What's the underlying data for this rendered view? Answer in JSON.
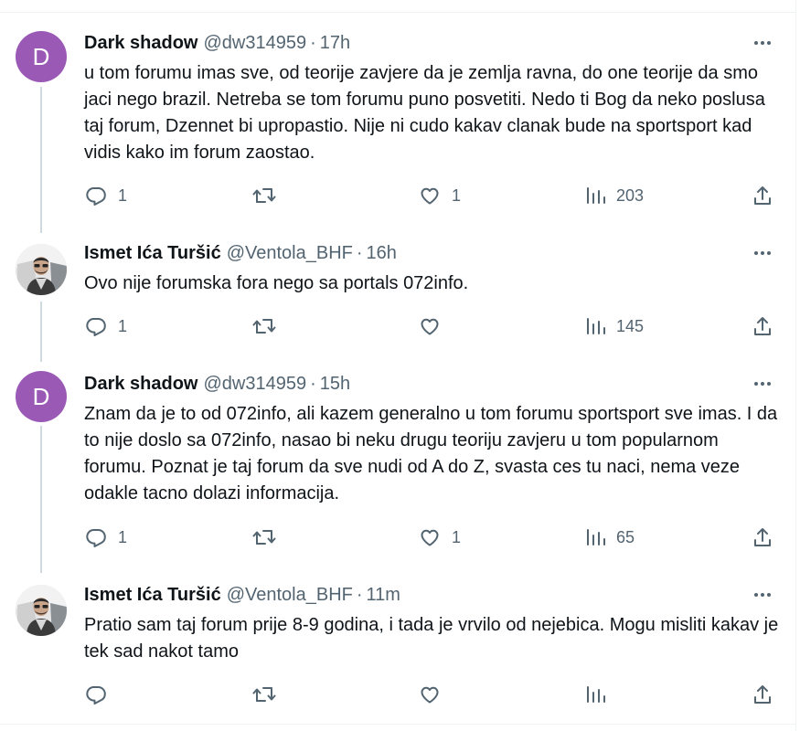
{
  "tweets": [
    {
      "avatar_letter": "D",
      "name": "Dark shadow",
      "handle": "@dw314959",
      "time": "17h",
      "text": "u tom forumu imas sve, od teorije zavjere da je zemlja ravna, do one teorije da smo jaci nego brazil. Netreba se tom forumu puno posvetiti. Nedo ti Bog da neko poslusa taj forum, Dzennet bi upropastio. Nije ni cudo kakav clanak bude na sportsport kad vidis kako im forum zaostao.",
      "replies": "1",
      "retweets": "",
      "likes": "1",
      "views": "203"
    },
    {
      "name": "Ismet Ića Turšić",
      "handle": "@Ventola_BHF",
      "time": "16h",
      "text": "Ovo nije forumska fora nego sa portals 072info.",
      "replies": "1",
      "retweets": "",
      "likes": "",
      "views": "145"
    },
    {
      "avatar_letter": "D",
      "name": "Dark shadow",
      "handle": "@dw314959",
      "time": "15h",
      "text": "Znam da je to od 072info, ali kazem generalno u tom forumu sportsport sve imas. I da to nije doslo sa 072info, nasao bi neku drugu teoriju zavjeru u tom popularnom forumu. Poznat je taj forum da sve nudi od A do Z, svasta ces tu naci, nema veze odakle tacno dolazi informacija.",
      "replies": "1",
      "retweets": "",
      "likes": "1",
      "views": "65"
    },
    {
      "name": "Ismet Ića Turšić",
      "handle": "@Ventola_BHF",
      "time": "11m",
      "text": "Pratio sam taj forum prije 8-9 godina, i tada je vrvilo od nejebica. Mogu misliti kakav je tek sad nakot tamo",
      "replies": "",
      "retweets": "",
      "likes": "",
      "views": ""
    }
  ],
  "separator": "·",
  "colors": {
    "text": "#0f1419",
    "secondary": "#536471",
    "avatar_purple": "#9b59b6",
    "thread_line": "#cfd9de"
  }
}
